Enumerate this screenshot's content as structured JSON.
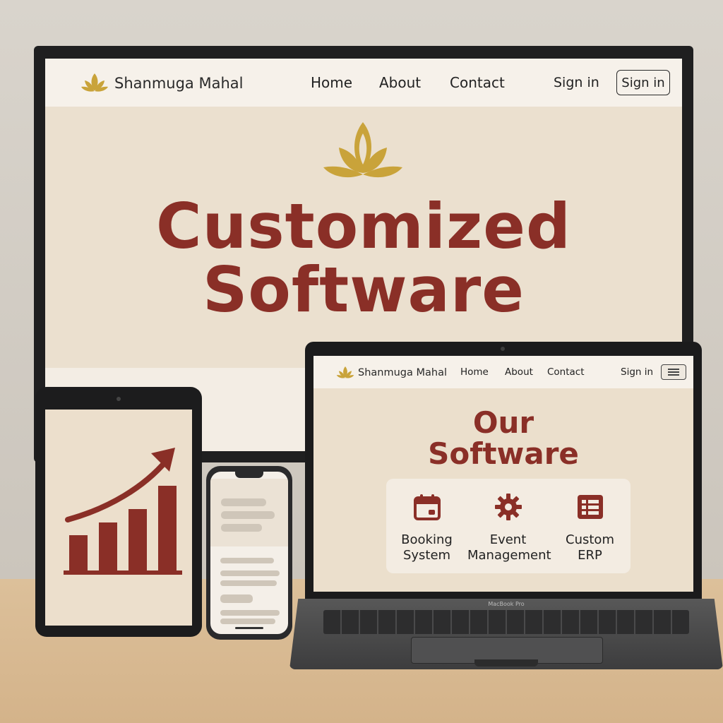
{
  "colors": {
    "brand_red": "#8a2f27",
    "lotus_gold": "#c9a33a",
    "cream": "#ebe0cf",
    "nav_bg": "#f6f1ea"
  },
  "monitor": {
    "brand": "Shanmuga Mahal",
    "nav": [
      "Home",
      "About",
      "Contact"
    ],
    "signin_link": "Sign in",
    "signin_button": "Sign in",
    "hero_title_line1": "Customized",
    "hero_title_line2": "Software",
    "hero_icon": "lotus-icon"
  },
  "tablet": {
    "chart_icon": "growth-chart-icon",
    "bars_relative": [
      0.42,
      0.6,
      0.75,
      1.0
    ]
  },
  "phone": {
    "content": "placeholder-lines"
  },
  "laptop": {
    "brand": "Shanmuga Mahal",
    "nav": [
      "Home",
      "About",
      "Contact"
    ],
    "signin_link": "Sign in",
    "menu_icon": "hamburger-menu-icon",
    "title_line1": "Our",
    "title_line2": "Software",
    "cards": [
      {
        "label": "Booking\nSystem",
        "icon": "calendar-icon"
      },
      {
        "label": "Event\nManagement",
        "icon": "gear-icon"
      },
      {
        "label": "Custom\nERP",
        "icon": "list-icon"
      }
    ],
    "model_text": "MacBook Pro"
  }
}
